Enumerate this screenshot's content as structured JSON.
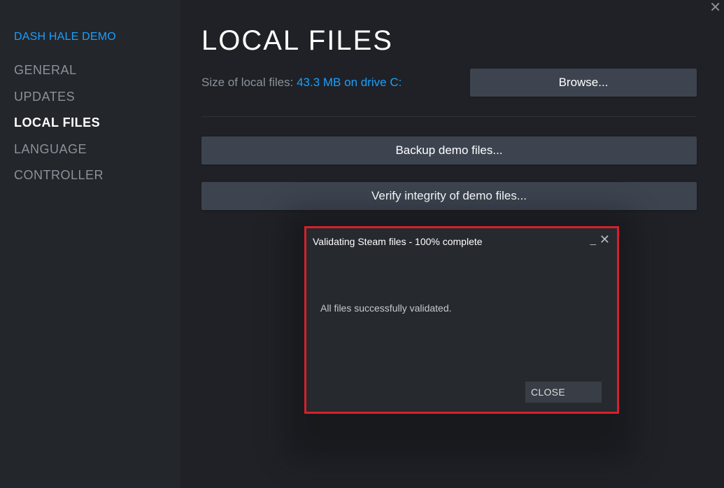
{
  "sidebar": {
    "game_title": "DASH HALE DEMO",
    "items": [
      {
        "label": "GENERAL"
      },
      {
        "label": "UPDATES"
      },
      {
        "label": "LOCAL FILES"
      },
      {
        "label": "LANGUAGE"
      },
      {
        "label": "CONTROLLER"
      }
    ],
    "active_index": 2
  },
  "main": {
    "title": "LOCAL FILES",
    "size_label": "Size of local files:",
    "size_value": "43.3 MB on drive C:",
    "browse_label": "Browse...",
    "backup_label": "Backup demo files...",
    "verify_label": "Verify integrity of demo files..."
  },
  "window": {
    "close_glyph": "✕"
  },
  "dialog": {
    "title": "Validating Steam files - 100% complete",
    "minimize_glyph": "_",
    "close_glyph": "✕",
    "message": "All files successfully validated.",
    "close_button_label": "CLOSE",
    "highlight_color": "#d6202b"
  },
  "colors": {
    "accent": "#1a9fff",
    "background": "#1f2126",
    "sidebar": "#23262b",
    "button": "#3d4450"
  }
}
